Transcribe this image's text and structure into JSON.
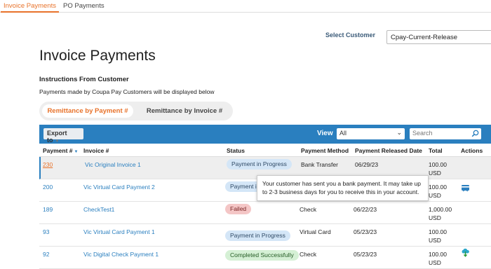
{
  "top_tabs": [
    "Invoice Payments",
    "PO Payments"
  ],
  "select_customer": {
    "label": "Select Customer",
    "value": "Cpay-Current-Release"
  },
  "page_title": "Invoice Payments",
  "instructions": {
    "heading": "Instructions From Customer",
    "text": "Payments made by Coupa Pay Customers will be displayed below"
  },
  "segments": {
    "active": "Remittance by Payment #",
    "inactive": "Remittance by Invoice #"
  },
  "toolbar": {
    "export_label": "Export to",
    "view_label": "View",
    "view_value": "All",
    "search_placeholder": "Search"
  },
  "table": {
    "headers": [
      "Payment #",
      "Invoice #",
      "Status",
      "Payment Method",
      "Payment Released Date",
      "Total",
      "Actions"
    ],
    "rows": [
      {
        "payment": "230",
        "invoice": "Vic Original Invoice 1",
        "status": "Payment in Progress",
        "method": "Bank Transfer",
        "date": "06/29/23",
        "total": "100.00",
        "currency": "USD",
        "action_icon": ""
      },
      {
        "payment": "200",
        "invoice": "Vic Virtual Card Payment 2",
        "status": "Payment in Progress",
        "method": "",
        "date": "",
        "total": "100.00",
        "currency": "USD",
        "action_icon": "card-icon"
      },
      {
        "payment": "189",
        "invoice": "CheckTest1",
        "status": "Failed",
        "method": "Check",
        "date": "06/22/23",
        "total": "1,000.00",
        "currency": "USD",
        "action_icon": ""
      },
      {
        "payment": "93",
        "invoice": "Vic Virtual Card Payment 1",
        "status": "Payment in Progress",
        "method": "Virtual Card",
        "date": "05/23/23",
        "total": "100.00",
        "currency": "USD",
        "action_icon": ""
      },
      {
        "payment": "92",
        "invoice": "Vic Digital Check Payment 1",
        "status": "Completed Successfully",
        "method": "Check",
        "date": "05/23/23",
        "total": "100.00",
        "currency": "USD",
        "action_icon": "cloud-download-icon"
      }
    ]
  },
  "tooltip": "Your customer has sent you a bank payment. It may take up to 2-3 business days for you to receive this in your account.",
  "colors": {
    "accent": "#e8722a",
    "brand_blue": "#2a7fbf"
  }
}
